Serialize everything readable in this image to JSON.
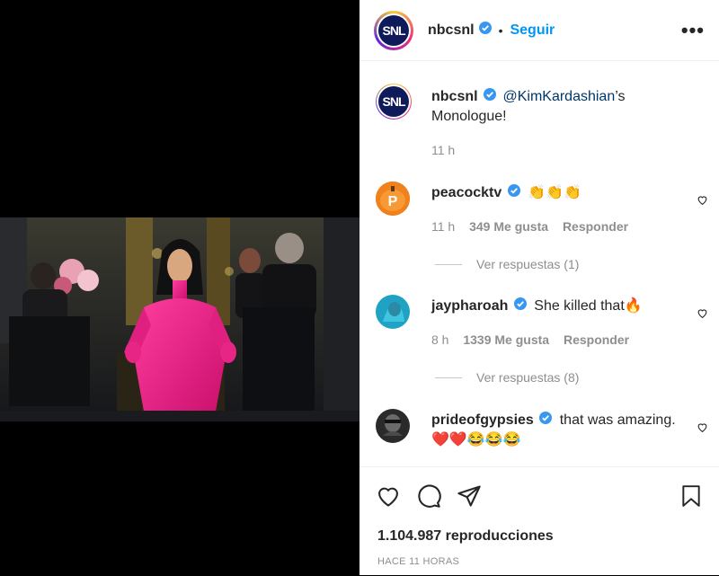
{
  "header": {
    "username": "nbcsnl",
    "separator": "•",
    "follow_label": "Seguir",
    "avatar_text": "SNL",
    "more_label": "•••"
  },
  "caption": {
    "username": "nbcsnl",
    "mention": "@KimKardashian",
    "text_tail": "’s Monologue!",
    "time": "11 h",
    "avatar_text": "SNL"
  },
  "comments": [
    {
      "username": "peacocktv",
      "text": "👏👏👏",
      "time": "11 h",
      "likes": "349 Me gusta",
      "reply": "Responder",
      "replies": "Ver respuestas (1)",
      "avatar_text": "P"
    },
    {
      "username": "jaypharoah",
      "text": "She killed that🔥",
      "time": "8 h",
      "likes": "1339 Me gusta",
      "reply": "Responder",
      "replies": "Ver respuestas (8)"
    },
    {
      "username": "prideofgypsies",
      "text": "that was amazing.",
      "text2": "❤️❤️😂😂😂"
    }
  ],
  "footer": {
    "views": "1.104.987 reproducciones",
    "ago": "HACE 11 HORAS"
  },
  "icons": {
    "like": "heart-icon",
    "comment": "comment-icon",
    "share": "share-icon",
    "save": "bookmark-icon",
    "verified": "verified-badge-icon"
  },
  "colors": {
    "accent": "#0095f6",
    "verified": "#3897f0",
    "dress": "#e6177f"
  }
}
